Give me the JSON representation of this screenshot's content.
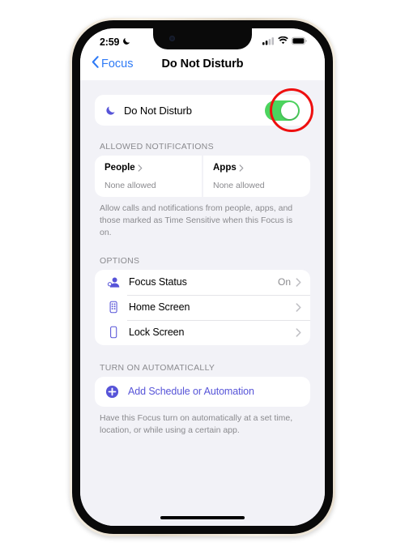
{
  "status_bar": {
    "time": "2:59",
    "moon_icon": "crescent-moon-icon",
    "signal_icon": "cellular-signal-icon",
    "wifi_icon": "wifi-icon",
    "battery_icon": "battery-full-icon"
  },
  "nav": {
    "back_label": "Focus",
    "back_icon": "chevron-left-icon",
    "title": "Do Not Disturb"
  },
  "main_toggle": {
    "icon": "crescent-moon-icon",
    "label": "Do Not Disturb",
    "state": "On",
    "annotation": "red-highlight-circle"
  },
  "allowed_notifications": {
    "header": "ALLOWED NOTIFICATIONS",
    "cards": [
      {
        "title": "People",
        "value": "None allowed",
        "chevron": "chevron-right-icon"
      },
      {
        "title": "Apps",
        "value": "None allowed",
        "chevron": "chevron-right-icon"
      }
    ],
    "footer": "Allow calls and notifications from people, apps, and those marked as Time Sensitive when this Focus is on."
  },
  "options": {
    "header": "OPTIONS",
    "rows": [
      {
        "icon": "focus-status-person-icon",
        "label": "Focus Status",
        "value": "On",
        "chevron": "chevron-right-icon"
      },
      {
        "icon": "home-screen-icon",
        "label": "Home Screen",
        "value": "",
        "chevron": "chevron-right-icon"
      },
      {
        "icon": "lock-screen-icon",
        "label": "Lock Screen",
        "value": "",
        "chevron": "chevron-right-icon"
      }
    ]
  },
  "turn_on_automatically": {
    "header": "TURN ON AUTOMATICALLY",
    "add_icon": "plus-circle-icon",
    "add_label": "Add Schedule or Automation",
    "footer": "Have this Focus turn on automatically at a set time, location, or while using a certain app."
  },
  "home_indicator": "home-indicator-bar",
  "colors": {
    "accent_purple": "#5754d8",
    "link_blue": "#2f7bf6",
    "toggle_green": "#4cd45e",
    "annotation_red": "#ee0f0f",
    "page_background": "#f2f2f7"
  }
}
